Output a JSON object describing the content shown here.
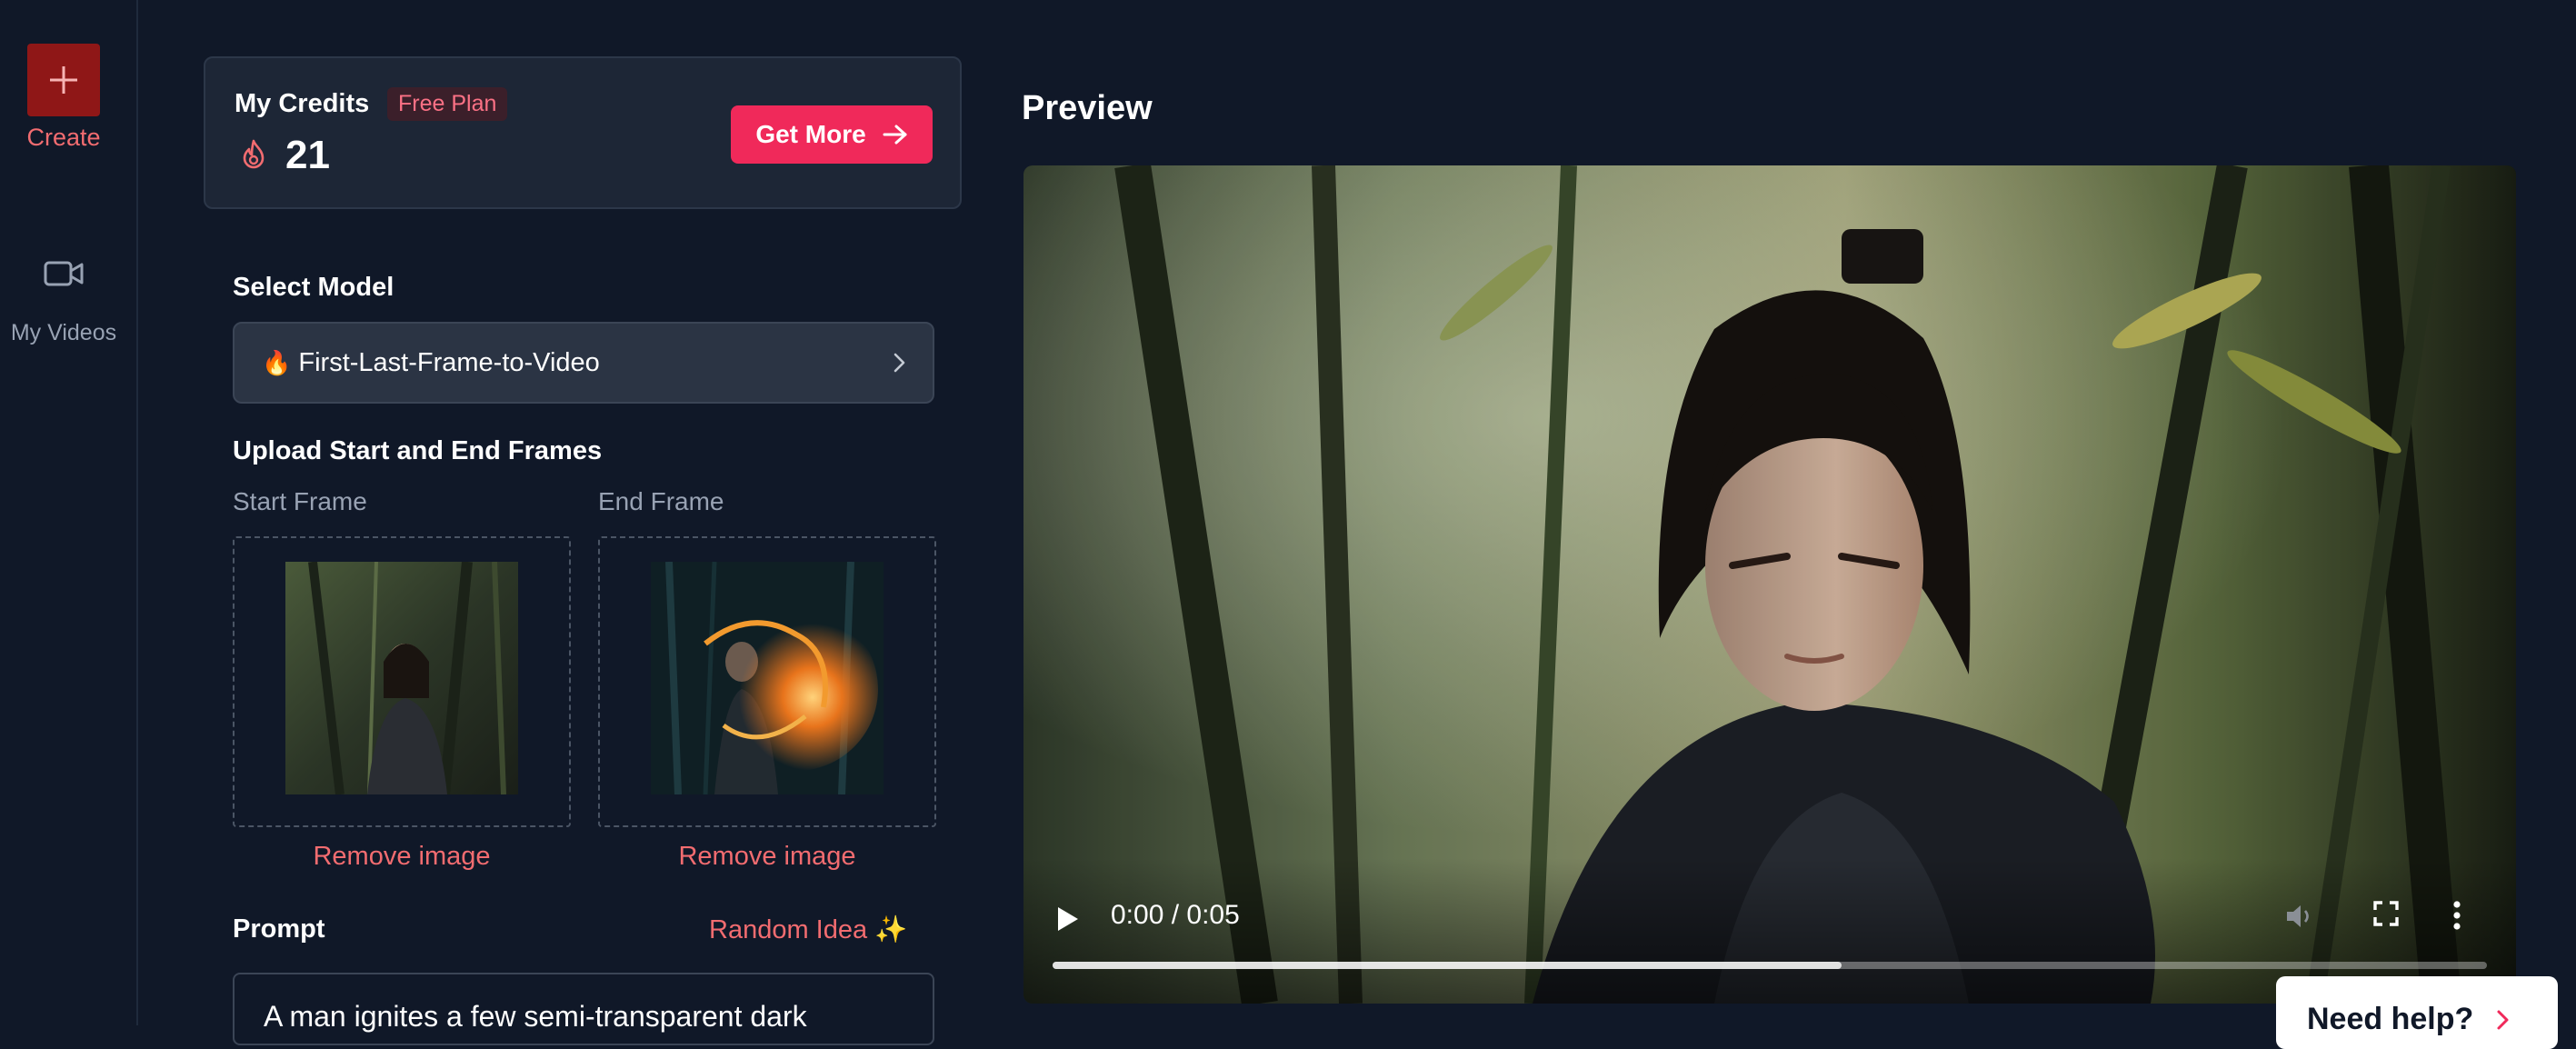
{
  "sidebar": {
    "create_label": "Create",
    "my_videos_label": "My Videos"
  },
  "credits": {
    "title": "My Credits",
    "plan": "Free Plan",
    "value": "21",
    "get_more_label": "Get More"
  },
  "model": {
    "section_label": "Select Model",
    "emoji": "🔥",
    "selected": "First-Last-Frame-to-Video"
  },
  "frames": {
    "section_label": "Upload Start and End Frames",
    "start_label": "Start Frame",
    "end_label": "End Frame",
    "remove_start": "Remove image",
    "remove_end": "Remove image"
  },
  "prompt": {
    "label": "Prompt",
    "random_idea": "Random Idea ✨",
    "value": "A man ignites a few semi-transparent dark"
  },
  "preview": {
    "title": "Preview",
    "time": "0:00 / 0:05",
    "progress": 0.55
  },
  "help": {
    "label": "Need help?"
  },
  "colors": {
    "accent": "#f0295a",
    "link": "#f26c70",
    "create_bg": "#8f1717",
    "background": "#101828"
  },
  "icons": [
    "plus-icon",
    "video-camera-icon",
    "flame-icon",
    "arrow-right-icon",
    "chevron-right-icon",
    "play-icon",
    "volume-icon",
    "fullscreen-icon",
    "more-vertical-icon",
    "sparkles-icon"
  ]
}
